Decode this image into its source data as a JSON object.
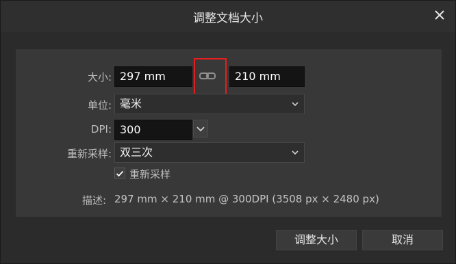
{
  "dialog": {
    "title": "调整文档大小",
    "close_icon": "close-icon"
  },
  "size": {
    "label": "大小:",
    "width_value": "297 mm",
    "height_value": "210 mm",
    "link_icon": "link-chain-icon"
  },
  "unit": {
    "label": "单位:",
    "selected": "毫米"
  },
  "dpi": {
    "label": "DPI:",
    "value": "300"
  },
  "resample": {
    "label": "重新采样:",
    "selected": "双三次",
    "checkbox_label": "重新采样",
    "checked": true
  },
  "description": {
    "label": "描述:",
    "value": "297 mm × 210 mm @ 300DPI (3508 px × 2480 px)"
  },
  "buttons": {
    "resize": "调整大小",
    "cancel": "取消"
  },
  "colors": {
    "highlight": "#e41e1e"
  }
}
